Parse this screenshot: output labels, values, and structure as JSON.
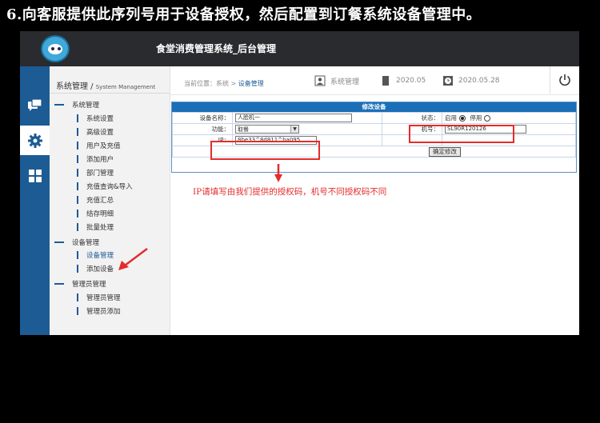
{
  "caption": "6.向客服提供此序列号用于设备授权，然后配置到订餐系统设备管理中。",
  "header": {
    "title": "食堂消费管理系统_后台管理"
  },
  "sidebar": {
    "title": "系统管理",
    "subtitle": "System Management",
    "groups": [
      {
        "label": "系统管理",
        "items": [
          "系统设置",
          "高级设置",
          "用户及充值",
          "添加用户",
          "部门管理",
          "充值查询&导入",
          "充值汇总",
          "结存明细",
          "批量处理"
        ]
      },
      {
        "label": "设备管理",
        "items": [
          "设备管理",
          "添加设备"
        ]
      },
      {
        "label": "管理员管理",
        "items": [
          "管理员管理",
          "管理员添加"
        ]
      }
    ],
    "active_item": "设备管理"
  },
  "breadcrumb": {
    "prefix": "当前位置：系统 > ",
    "current": "设备管理"
  },
  "status": {
    "user": "系统管理",
    "version": "2020.05",
    "date": "2020.05.28"
  },
  "form": {
    "title": "修改设备",
    "device_name_label": "设备名称：",
    "device_name_value": "人脸机一",
    "state_label": "状态：",
    "state_enabled": "启用",
    "state_disabled": "停用",
    "function_label": "功能：",
    "function_value": "取餐",
    "machine_no_label": "机号：",
    "machine_no_value": "SL90R120126",
    "ip_label": "IP：",
    "ip_value": "8be33^8d811^ba095",
    "submit_label": "确定修改"
  },
  "annotation": "IP请填写由我们提供的授权码，机号不同授权码不同",
  "colors": {
    "nav_blue": "#1d5b95",
    "form_header": "#1a6fb8",
    "highlight_red": "#e52b2b",
    "topbar": "#2a2b2f"
  }
}
